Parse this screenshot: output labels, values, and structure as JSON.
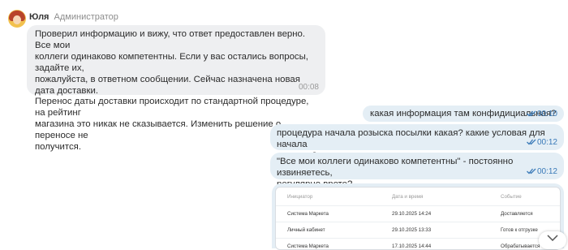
{
  "incoming": {
    "sender_name": "Юля",
    "sender_role": "Администратор",
    "text": "Проверил информацию и вижу, что ответ предоставлен верно. Все мои\nколлеги одинаково компетентны. Если у вас остались вопросы, задайте их,\nпожалуйста, в ответном сообщении. Сейчас назначена новая дата доставки.\nПеренос даты доставки происходит по стандартной процедуре, на рейтинг\nмагазина это никак не сказывается. Изменить решение о переносе не\nполучится.",
    "time": "00:08"
  },
  "outgoing": [
    {
      "text": "какая информация там конфидициальная?",
      "time": "00:10"
    },
    {
      "text": "процедура начала розыска посылки какая? какие условая для начала\nрозыска?",
      "time": "00:12"
    },
    {
      "text": "\"Все мои коллеги одинаково компетентны\" - постоянно извиняетесь,\nрегулярно врете?",
      "time": "00:12"
    }
  ],
  "attachment_table": {
    "headers": [
      "Инициатор",
      "Дата и время",
      "Событие"
    ],
    "rows": [
      [
        "Система Маркета",
        "29.10.2025 14:24",
        "Доставляется"
      ],
      [
        "Личный кабинет",
        "29.10.2025 13:33",
        "Готов к отгрузке"
      ],
      [
        "Система Маркета",
        "17.10.2025 14:44",
        "Обрабатывается"
      ]
    ]
  },
  "icons": {
    "read": "double-check-icon",
    "scroll": "chevron-down-icon",
    "avatar": "avatar"
  },
  "colors": {
    "incoming_bubble": "#eeeff1",
    "outgoing_bubble": "#e4eef5",
    "read_check": "#3a7ab8"
  }
}
